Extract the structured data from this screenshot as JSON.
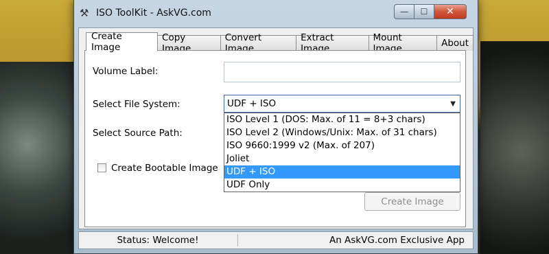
{
  "window": {
    "title": "ISO ToolKit - AskVG.com",
    "minimize_glyph": "—",
    "maximize_glyph": "☐",
    "close_glyph": "✕"
  },
  "tabs": [
    {
      "label": "Create Image",
      "active": true
    },
    {
      "label": "Copy Image",
      "active": false
    },
    {
      "label": "Convert Image",
      "active": false
    },
    {
      "label": "Extract Image",
      "active": false
    },
    {
      "label": "Mount Image",
      "active": false
    },
    {
      "label": "About",
      "active": false
    }
  ],
  "form": {
    "volume_label": "Volume Label:",
    "volume_value": "",
    "file_system_label": "Select File System:",
    "file_system_value": "UDF + ISO",
    "file_system_options": [
      "ISO Level 1 (DOS: Max. of 11 = 8+3 chars)",
      "ISO Level 2 (Windows/Unix: Max. of 31 chars)",
      "ISO 9660:1999 v2 (Max. of 207)",
      "Joliet",
      "UDF + ISO",
      "UDF Only"
    ],
    "selected_option_index": 4,
    "source_path_label": "Select Source Path:",
    "bootable_label": "Create Bootable Image",
    "bootable_checked": false,
    "create_button": "Create Image"
  },
  "status": {
    "left": "Status: Welcome!",
    "right": "An AskVG.com Exclusive App"
  },
  "icons": {
    "app": "wand-icon",
    "dropdown": "chevron-down-icon"
  }
}
